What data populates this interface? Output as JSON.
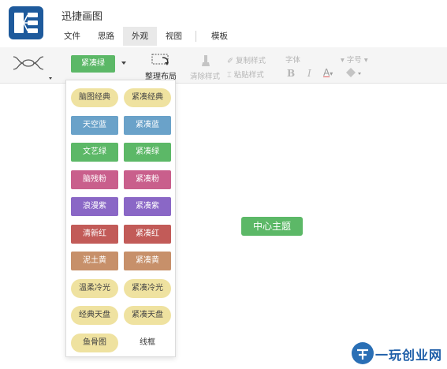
{
  "app": {
    "title": "迅捷画图"
  },
  "menu": {
    "items": [
      {
        "label": "文件",
        "active": false
      },
      {
        "label": "思路",
        "active": false
      },
      {
        "label": "外观",
        "active": true
      },
      {
        "label": "视图",
        "active": false
      },
      {
        "label": "模板",
        "active": false
      }
    ]
  },
  "toolbar": {
    "theme_label": "紧凑绿",
    "layout_label": "整理布局",
    "clear_label": "清除样式",
    "copy_style_label": "复制样式",
    "paste_style_label": "粘贴样式",
    "font_label": "字体",
    "fontsize_label": "字号",
    "bold_label": "B",
    "italic_label": "I",
    "fontcolor_label": "A",
    "structure_icon": "mindmap-structure-icon",
    "layout_icon": "arrange-layout-icon",
    "clear_icon": "clear-format-brush-icon",
    "fill_icon": "fill-bucket-icon",
    "theme_color": "#5cb867"
  },
  "theme_menu": {
    "items": [
      {
        "label": "脑图经典",
        "style": "pill",
        "color": "#efe2a0"
      },
      {
        "label": "紧凑经典",
        "style": "pill",
        "color": "#efe2a0"
      },
      {
        "label": "天空蓝",
        "style": "rect",
        "color": "#6aa2c9"
      },
      {
        "label": "紧凑蓝",
        "style": "rect",
        "color": "#6aa2c9"
      },
      {
        "label": "文艺绿",
        "style": "rect",
        "color": "#5cb867"
      },
      {
        "label": "紧凑绿",
        "style": "rect",
        "color": "#5cb867"
      },
      {
        "label": "脑残粉",
        "style": "rect",
        "color": "#c95f8c"
      },
      {
        "label": "紧凑粉",
        "style": "rect",
        "color": "#c95f8c"
      },
      {
        "label": "浪漫紫",
        "style": "rect",
        "color": "#8a67c6"
      },
      {
        "label": "紧凑紫",
        "style": "rect",
        "color": "#8a67c6"
      },
      {
        "label": "清新红",
        "style": "rect",
        "color": "#c25b58"
      },
      {
        "label": "紧凑红",
        "style": "rect",
        "color": "#c25b58"
      },
      {
        "label": "泥土黄",
        "style": "rect",
        "color": "#c7906a"
      },
      {
        "label": "紧凑黄",
        "style": "rect",
        "color": "#c7906a"
      },
      {
        "label": "温柔冷光",
        "style": "pill",
        "color": "#efe2a0"
      },
      {
        "label": "紧凑冷光",
        "style": "pill",
        "color": "#efe2a0"
      },
      {
        "label": "经典天盘",
        "style": "pill",
        "color": "#efe2a0"
      },
      {
        "label": "紧凑天盘",
        "style": "pill",
        "color": "#efe2a0"
      },
      {
        "label": "鱼骨图",
        "style": "pill",
        "color": "#efe2a0"
      },
      {
        "label": "线框",
        "style": "plain",
        "color": ""
      }
    ]
  },
  "canvas": {
    "center_node": "中心主题",
    "node_color": "#5cb867"
  },
  "watermark": {
    "text": "一玩创业网"
  }
}
